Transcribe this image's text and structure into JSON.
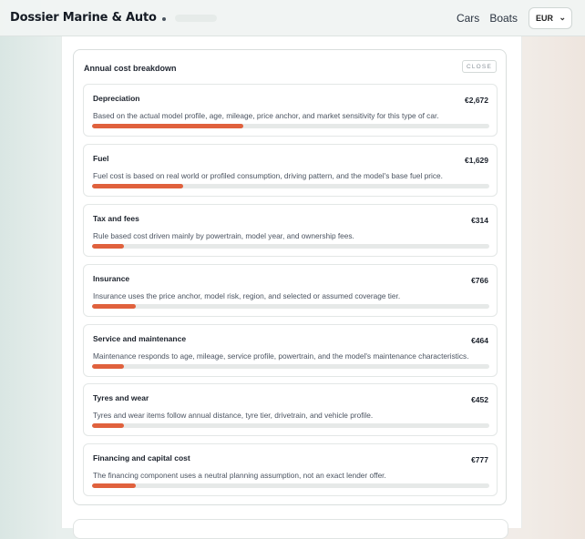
{
  "header": {
    "brand": "Dossier Marine & Auto",
    "nav": [
      {
        "label": "Cars"
      },
      {
        "label": "Boats"
      }
    ],
    "currency": "EUR"
  },
  "panel": {
    "title": "Annual cost breakdown",
    "close_label": "CLOSE",
    "items": [
      {
        "title": "Depreciation",
        "amount": "€2,672",
        "description": "Based on the actual model profile, age, mileage, price anchor, and market sensitivity for this type of car.",
        "share": 0.38
      },
      {
        "title": "Fuel",
        "amount": "€1,629",
        "description": "Fuel cost is based on real world or profiled consumption, driving pattern, and the model's base fuel price.",
        "share": 0.23
      },
      {
        "title": "Tax and fees",
        "amount": "€314",
        "description": "Rule based cost driven mainly by powertrain, model year, and ownership fees.",
        "share": 0.08
      },
      {
        "title": "Insurance",
        "amount": "€766",
        "description": "Insurance uses the price anchor, model risk, region, and selected or assumed coverage tier.",
        "share": 0.11
      },
      {
        "title": "Service and maintenance",
        "amount": "€464",
        "description": "Maintenance responds to age, mileage, service profile, powertrain, and the model's maintenance characteristics.",
        "share": 0.08
      },
      {
        "title": "Tyres and wear",
        "amount": "€452",
        "description": "Tyres and wear items follow annual distance, tyre tier, drivetrain, and vehicle profile.",
        "share": 0.08
      },
      {
        "title": "Financing and capital cost",
        "amount": "€777",
        "description": "The financing component uses a neutral planning assumption, not an exact lender offer.",
        "share": 0.11
      }
    ]
  },
  "colors": {
    "accent": "#e0613d",
    "track": "#e6e9e8"
  }
}
